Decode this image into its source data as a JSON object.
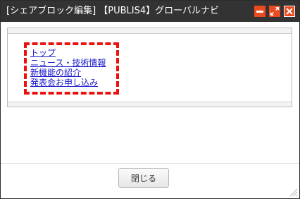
{
  "window": {
    "title": "[シェアブロック編集] 【PUBLIS4】グローバルナビ",
    "controls": {
      "minimize_icon": "minimize-icon",
      "maximize_icon": "maximize-icon",
      "close_icon": "close-icon"
    }
  },
  "nav": {
    "items": [
      {
        "label": "トップ"
      },
      {
        "label": "ニュース・技術情報"
      },
      {
        "label": "新機能の紹介"
      },
      {
        "label": "発表会お申し込み"
      }
    ]
  },
  "footer": {
    "close_label": "閉じる"
  },
  "colors": {
    "titlebar": "#333333",
    "accent": "#ea4a1f",
    "highlight_frame": "#e8130e",
    "link": "#1a1acd"
  }
}
